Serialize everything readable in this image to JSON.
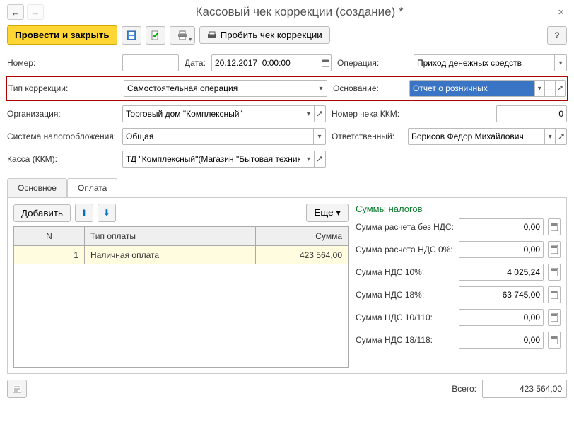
{
  "title": "Кассовый чек коррекции (создание) *",
  "toolbar": {
    "submit": "Провести и закрыть",
    "punch": "Пробить чек коррекции",
    "help": "?"
  },
  "fields": {
    "number_label": "Номер:",
    "number": "",
    "date_label": "Дата:",
    "date": "20.12.2017  0:00:00",
    "operation_label": "Операция:",
    "operation": "Приход денежных средств",
    "corrtype_label": "Тип коррекции:",
    "corrtype": "Самостоятельная операция",
    "basis_label": "Основание:",
    "basis": "Отчет о розничных",
    "org_label": "Организация:",
    "org": "Торговый дом \"Комплексный\"",
    "kkm_num_label": "Номер чека ККМ:",
    "kkm_num": "0",
    "taxsys_label": "Система налогообложения:",
    "taxsys": "Общая",
    "resp_label": "Ответственный:",
    "resp": "Борисов Федор Михайлович",
    "kassa_label": "Касса (ККМ):",
    "kassa": "ТД \"Комплексный\"(Магазин \"Бытовая техника\")"
  },
  "tabs": {
    "main": "Основное",
    "pay": "Оплата"
  },
  "payment": {
    "add": "Добавить",
    "more": "Еще",
    "header": {
      "n": "N",
      "type": "Тип оплаты",
      "sum": "Сумма"
    },
    "rows": [
      {
        "n": "1",
        "type": "Наличная оплата",
        "sum": "423 564,00"
      }
    ]
  },
  "taxes": {
    "title": "Суммы налогов",
    "no_nds_label": "Сумма расчета без НДС:",
    "no_nds": "0,00",
    "nds0_label": "Сумма расчета НДС 0%:",
    "nds0": "0,00",
    "nds10_label": "Сумма НДС 10%:",
    "nds10": "4 025,24",
    "nds18_label": "Сумма НДС 18%:",
    "nds18": "63 745,00",
    "nds10_110_label": "Сумма НДС 10/110:",
    "nds10_110": "0,00",
    "nds18_118_label": "Сумма НДС 18/118:",
    "nds18_118": "0,00"
  },
  "footer": {
    "total_label": "Всего:",
    "total": "423 564,00"
  }
}
